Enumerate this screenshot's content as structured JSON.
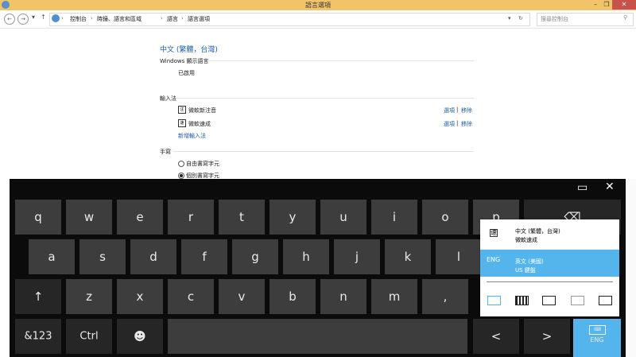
{
  "window": {
    "title": "語言選項"
  },
  "address": {
    "crumbs": [
      "控制台",
      "時鐘、語言和區域",
      "語言",
      "語言選項"
    ],
    "search_placeholder": "搜尋控制台"
  },
  "content": {
    "language_title": "中文 (繁體，台灣)",
    "windows_display_language_heading": "Windows 顯示語言",
    "windows_display_language_status": "已啟用",
    "input_method_heading": "輸入法",
    "input_methods": [
      {
        "icon": "注",
        "name": "微軟新注音",
        "options": "選項",
        "sep": "|",
        "remove": "移除"
      },
      {
        "icon": "速",
        "name": "微軟速成",
        "options": "選項",
        "sep": "|",
        "remove": "移除"
      }
    ],
    "add_input_method": "新增輸入法",
    "handwriting_heading": "手寫",
    "handwriting_options": [
      {
        "label": "自由書寫字元",
        "selected": false
      },
      {
        "label": "個別書寫字元",
        "selected": true
      }
    ]
  },
  "keyboard": {
    "row1": [
      "q",
      "w",
      "e",
      "r",
      "t",
      "y",
      "u",
      "i",
      "o",
      "p"
    ],
    "row2": [
      "a",
      "s",
      "d",
      "f",
      "g",
      "h",
      "j",
      "k",
      "l"
    ],
    "row3": [
      "z",
      "x",
      "c",
      "v",
      "b",
      "n",
      "m",
      ",",
      "."
    ],
    "shift": "↑",
    "sym": "&123",
    "ctrl": "Ctrl",
    "emoji": "☻",
    "left": "<",
    "right": ">",
    "lang_key": "ENG",
    "close": "✕"
  },
  "language_popup": {
    "items": [
      {
        "code": "速",
        "line1": "中文 (繁體，台灣)",
        "line2": "微軟速成",
        "selected": false
      },
      {
        "code": "ENG",
        "line1": "英文 (美國)",
        "line2": "US 鍵盤",
        "selected": true
      }
    ],
    "accent_color": "#54b5ec"
  }
}
